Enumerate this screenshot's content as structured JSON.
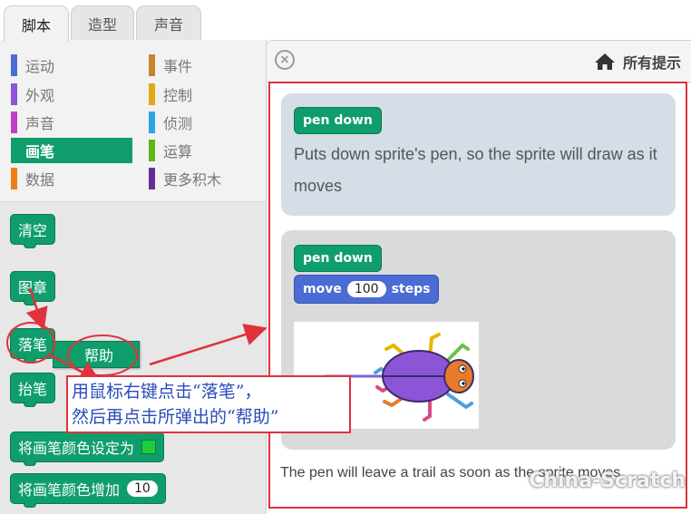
{
  "tabs": [
    {
      "label": "脚本",
      "active": true
    },
    {
      "label": "造型",
      "active": false
    },
    {
      "label": "声音",
      "active": false
    }
  ],
  "categories": [
    {
      "label": "运动",
      "color": "#4a6cd4"
    },
    {
      "label": "事件",
      "color": "#c88330"
    },
    {
      "label": "外观",
      "color": "#8a55d7"
    },
    {
      "label": "控制",
      "color": "#e1a91a"
    },
    {
      "label": "声音",
      "color": "#bb42c3"
    },
    {
      "label": "侦测",
      "color": "#2ca5e2"
    },
    {
      "label": "画笔",
      "color": "#0e9a6c",
      "selected": true
    },
    {
      "label": "运算",
      "color": "#5cb712"
    },
    {
      "label": "数据",
      "color": "#ee7d16"
    },
    {
      "label": "更多积木",
      "color": "#632d99"
    }
  ],
  "blocks": {
    "clear": "清空",
    "stamp": "图章",
    "pen_down": "落笔",
    "pen_up": "抬笔",
    "set_color": "将画笔颜色设定为",
    "change_color": "将画笔颜色增加",
    "change_color_value": "10"
  },
  "context_menu": {
    "help": "帮助"
  },
  "help_panel": {
    "all_tips": "所有提示",
    "card1": {
      "block_label": "pen down",
      "description": "Puts down sprite's pen, so the sprite will draw as it moves"
    },
    "card2": {
      "block_label": "pen down",
      "move_label": "move",
      "move_value": "100",
      "move_unit": "steps"
    },
    "footer": "The pen will leave a trail as soon as the sprite moves."
  },
  "callout": {
    "line1": "用鼠标右键点击“落笔”，",
    "line2": "然后再点击所弹出的“帮助”"
  },
  "watermark": "China-Scratch",
  "colors": {
    "pen": "#0f9e6b",
    "motion": "#4a6cd4",
    "annotation": "#e0323c",
    "callout_text": "#2b4bb8"
  }
}
